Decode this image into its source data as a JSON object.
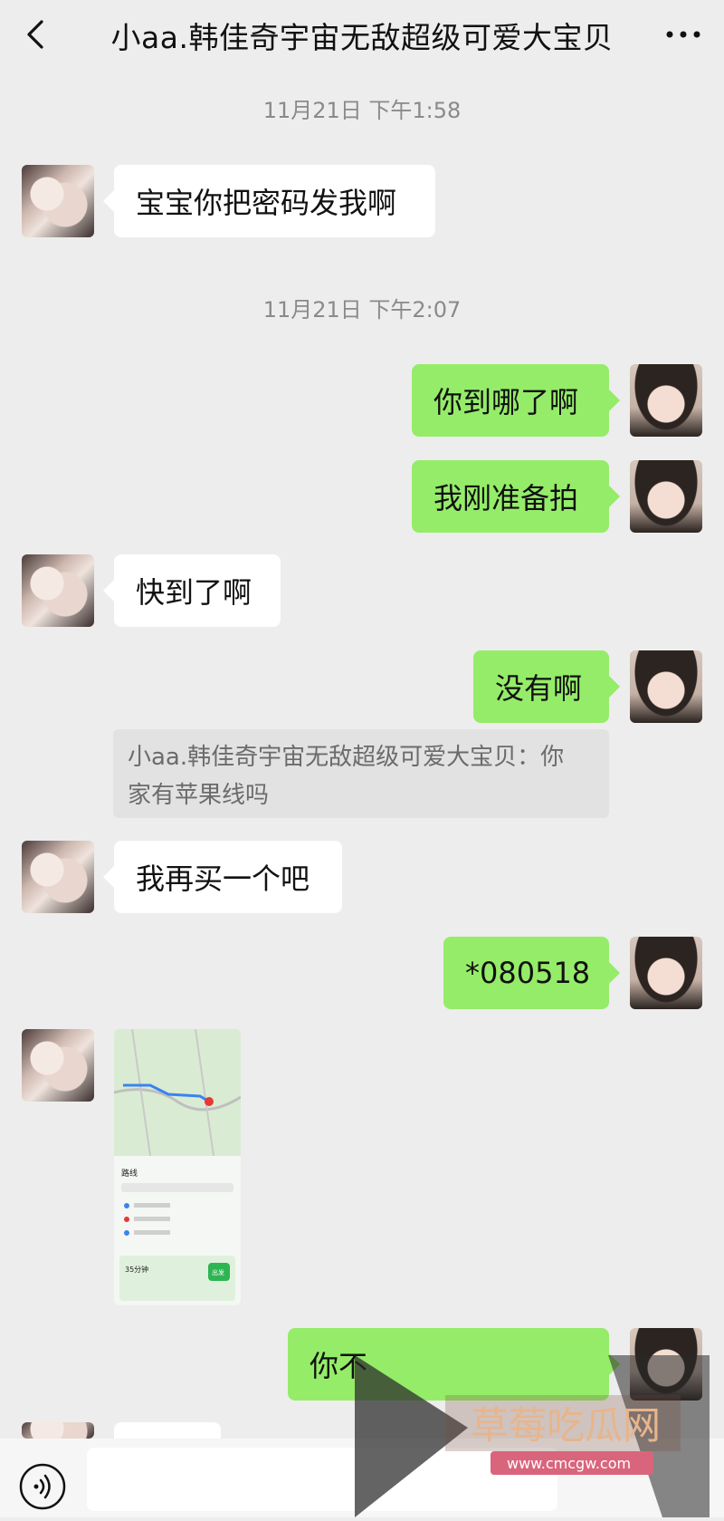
{
  "header": {
    "title": "小aa.韩佳奇宇宙无敌超级可爱大宝贝",
    "back_icon": "chevron-left-icon",
    "more_icon": "more-icon"
  },
  "messages": {
    "ts1": "11月21日 下午1:58",
    "m1": "宝宝你把密码发我啊",
    "ts2": "11月21日 下午2:07",
    "m2": "你到哪了啊",
    "m3": "我刚准备拍",
    "m4": "快到了啊",
    "m5": "没有啊",
    "quote_line1": "小aa.韩佳奇宇宙无敌超级可爱大宝贝：你",
    "quote_line2": "家有苹果线吗",
    "m6": "我再买一个吧",
    "m7": "*080518",
    "m8_partial": "你不"
  },
  "map": {
    "panel_title": "路线",
    "duration": "35分钟",
    "go_button": "出发"
  },
  "footer": {
    "voice_icon": "voice-icon"
  },
  "watermark": {
    "name": "草莓吃瓜网",
    "url": "www.cmcgw.com"
  },
  "colors": {
    "accent_green": "#95ec69",
    "background": "#ededed"
  }
}
